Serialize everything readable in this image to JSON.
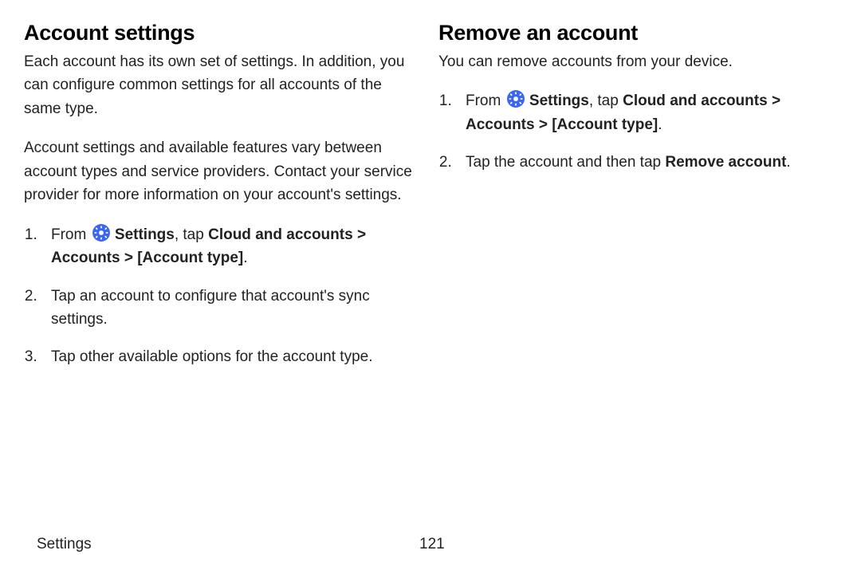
{
  "left": {
    "heading": "Account settings",
    "para1": "Each account has its own set of settings. In addition, you can configure common settings for all accounts of the same type.",
    "para2": "Account settings and available features vary between account types and service providers. Contact your service provider for more information on your account's settings.",
    "step1_pre": "From ",
    "step1_settings": "Settings",
    "step1_mid": ", tap ",
    "step1_cloud": "Cloud and accounts",
    "step1_gt1": " > ",
    "step1_accounts": "Accounts",
    "step1_gt2": " > ",
    "step1_type": "[Account type]",
    "step1_end": ".",
    "step2": "Tap an account to configure that account's sync settings.",
    "step3": "Tap other available options for the account type."
  },
  "right": {
    "heading": "Remove an account",
    "para1": "You can remove accounts from your device.",
    "step1_pre": "From ",
    "step1_settings": "Settings",
    "step1_mid": ", tap ",
    "step1_cloud": "Cloud and accounts",
    "step1_gt1": " > ",
    "step1_accounts": "Accounts",
    "step1_gt2": " > ",
    "step1_type": "[Account type]",
    "step1_end": ".",
    "step2_pre": "Tap the account and then tap ",
    "step2_bold": "Remove account",
    "step2_end": "."
  },
  "footer": {
    "section": "Settings",
    "page": "121"
  },
  "colors": {
    "gear_bg": "#3a66f0"
  }
}
